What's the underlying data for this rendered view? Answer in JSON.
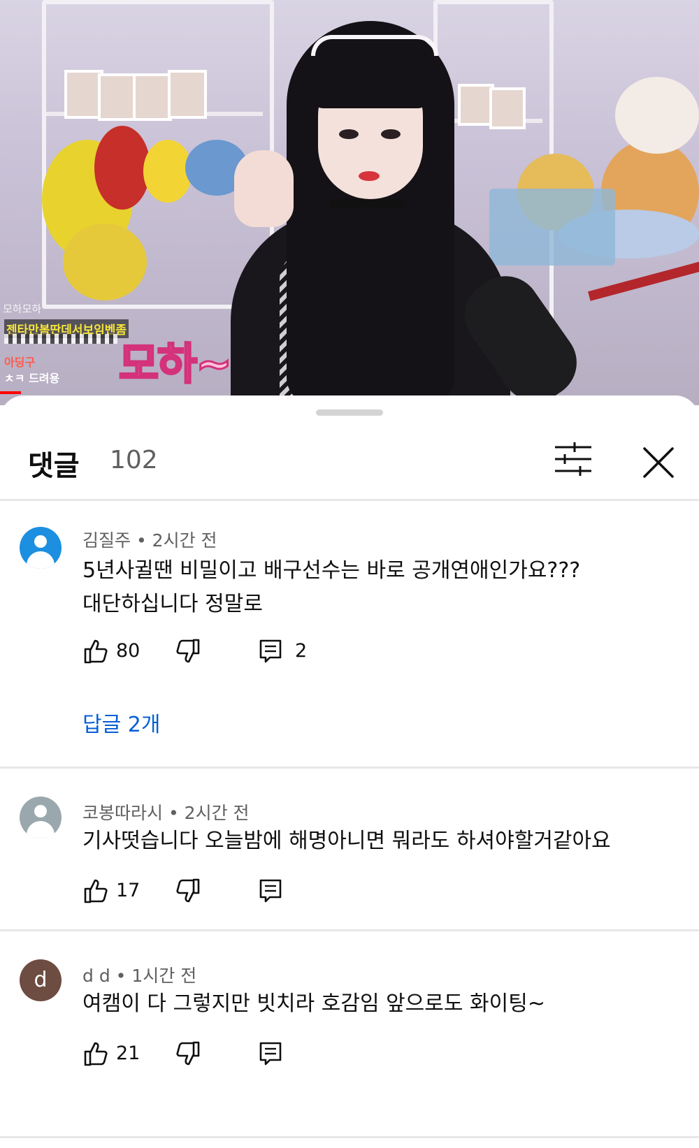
{
  "video": {
    "overlay": {
      "nickname_small": "모하모하",
      "banner_yellow": "젠타만봄딴데서보임벤좀",
      "chat_user": "아딩구",
      "chat_message": "ㅊㅋ 드려용",
      "sticker_text": "모하~"
    }
  },
  "comments_panel": {
    "title": "댓글",
    "count": "102",
    "filter_icon": "sliders-icon",
    "close_icon": "close-icon"
  },
  "comments": [
    {
      "author": "김질주",
      "time": "2시간 전",
      "avatar": "person-icon",
      "avatar_color": "#1c8fe0",
      "lines": [
        "5년사귈땐 비밀이고 배구선수는 바로 공개연애인가요???",
        "대단하십니다 정말로"
      ],
      "likes": "80",
      "reply_count": "2",
      "replies_label": "답글 2개"
    },
    {
      "author": "코봉따라시",
      "time": "2시간 전",
      "avatar": "person-icon",
      "avatar_color": "#9aa8ae",
      "lines": [
        "기사떳습니다 오늘밤에 해명아니면 뭐라도 하셔야할거같아요"
      ],
      "likes": "17"
    },
    {
      "author": "d d",
      "time": "1시간 전",
      "avatar_letter": "d",
      "avatar_color": "#6d4c41",
      "lines": [
        "여캠이 다 그렇지만 빗치라 호감임 앞으로도 화이팅~"
      ],
      "likes": "21"
    }
  ],
  "icons": {
    "like": "thumbs-up-icon",
    "dislike": "thumbs-down-icon",
    "reply": "comment-reply-icon"
  },
  "colors": {
    "link": "#065fd4",
    "text_secondary": "#606060",
    "divider": "#e7e7e7"
  }
}
